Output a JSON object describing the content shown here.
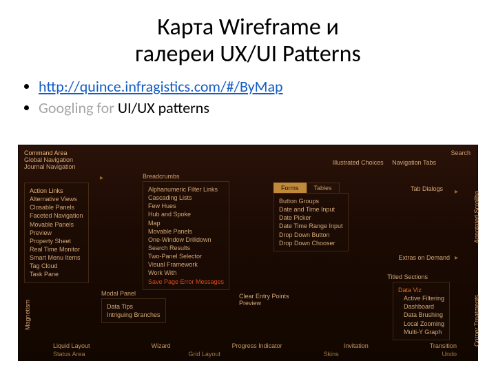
{
  "title_line1": "Карта Wireframe и",
  "title_line2": "галереи UX/UI Patterns",
  "bullets": {
    "link_text": "http://quince.infragistics.com/#/ByMap",
    "googling_gray": "Googling for ",
    "googling_black": "UI/UX patterns"
  },
  "screenshot": {
    "top_left": [
      "Command Area",
      "Global Navigation",
      "Journal Navigation"
    ],
    "top_right": [
      "Illustrated Choices",
      "Navigation Tabs"
    ],
    "search": "Search",
    "left_panel": [
      "Action Links",
      "Alternative Views",
      "Closable Panels",
      "Faceted Navigation",
      "Movable Panels",
      "Preview",
      "Property Sheet",
      "Real Time Monitor",
      "Smart Menu Items",
      "Tag Cloud",
      "Task Pane"
    ],
    "breadcrumbs_title": "Breadcrumbs",
    "breadcrumbs_items": [
      "Alphanumeric Filter Links",
      "Cascading Lists",
      "Few Hues",
      "Hub and Spoke",
      "Map",
      "Movable Panels",
      "One-Window Drilldown",
      "Search Results",
      "Two-Panel Selector",
      "Visual Framework",
      "Work With"
    ],
    "save_msg": "Save Page Error Messages",
    "modal_title": "Modal Panel",
    "modal_items": [
      "Data Tips",
      "Intriguing Branches"
    ],
    "magnetism_label": "Magnetism",
    "tabs": {
      "forms": "Forms",
      "tables": "Tables"
    },
    "tabs_panel_items": [
      "Button Groups",
      "Date and Time Input",
      "Date Picker",
      "Date Time Range Input",
      "Drop Down Button",
      "Drop Down Chooser"
    ],
    "tab_dialogs": "Tab Dialogs",
    "extras": "Extras on Demand",
    "titled_title": "Titled Sections",
    "titled_highlight": "Data Viz",
    "titled_items": [
      "Active Filtering",
      "Dashboard",
      "Data Brushing",
      "Local Zooming",
      "Multi-Y Graph"
    ],
    "clear_entry": [
      "Clear Entry Points",
      "Preview"
    ],
    "scrollbar_label": "Annotated Scrollba",
    "corner_label": "Corner Treatments",
    "bottom_upper": [
      "Liquid Layout",
      "Wizard",
      "Progress Indicator",
      "Invitation",
      "Transition"
    ],
    "bottom_lower": [
      "Status Area",
      "Grid Layout",
      "Skins",
      "Undo"
    ]
  }
}
